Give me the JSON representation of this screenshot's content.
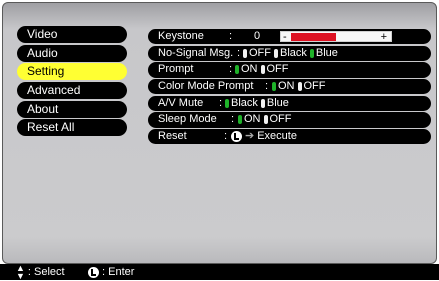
{
  "menu": {
    "items": [
      {
        "label": "Video"
      },
      {
        "label": "Audio"
      },
      {
        "label": "Setting"
      },
      {
        "label": "Advanced"
      },
      {
        "label": "About"
      },
      {
        "label": "Reset All"
      }
    ],
    "selected": "Setting"
  },
  "settings": {
    "keystone": {
      "label": "Keystone",
      "sep": ":",
      "value": "0",
      "minus": "-",
      "plus": "+",
      "level_fraction": 0.5
    },
    "no_signal": {
      "label": "No-Signal Msg.",
      "sep": ":",
      "options": [
        "OFF",
        "Black",
        "Blue"
      ],
      "selected": "Blue"
    },
    "prompt": {
      "label": "Prompt",
      "sep": ":",
      "options": [
        "ON",
        "OFF"
      ],
      "selected": "ON"
    },
    "color_mode_prompt": {
      "label": "Color Mode Prompt",
      "sep": ":",
      "options": [
        "ON",
        "OFF"
      ],
      "selected": "ON"
    },
    "av_mute": {
      "label": "A/V Mute",
      "sep": ":",
      "options": [
        "Black",
        "Blue"
      ],
      "selected": "Black"
    },
    "sleep_mode": {
      "label": "Sleep Mode",
      "sep": ":",
      "options": [
        "ON",
        "OFF"
      ],
      "selected": "ON"
    },
    "reset": {
      "label": "Reset",
      "sep": ":",
      "action": "Execute",
      "icon": "enter-icon"
    }
  },
  "footer": {
    "select_label": ": Select",
    "enter_label": ": Enter",
    "select_icon": "up-down-arrows-icon",
    "enter_icon": "enter-icon"
  },
  "colors": {
    "selected_menu": "#ffff33",
    "selected_option": "#1fb32a",
    "keystone_fill": "#dd1122"
  }
}
